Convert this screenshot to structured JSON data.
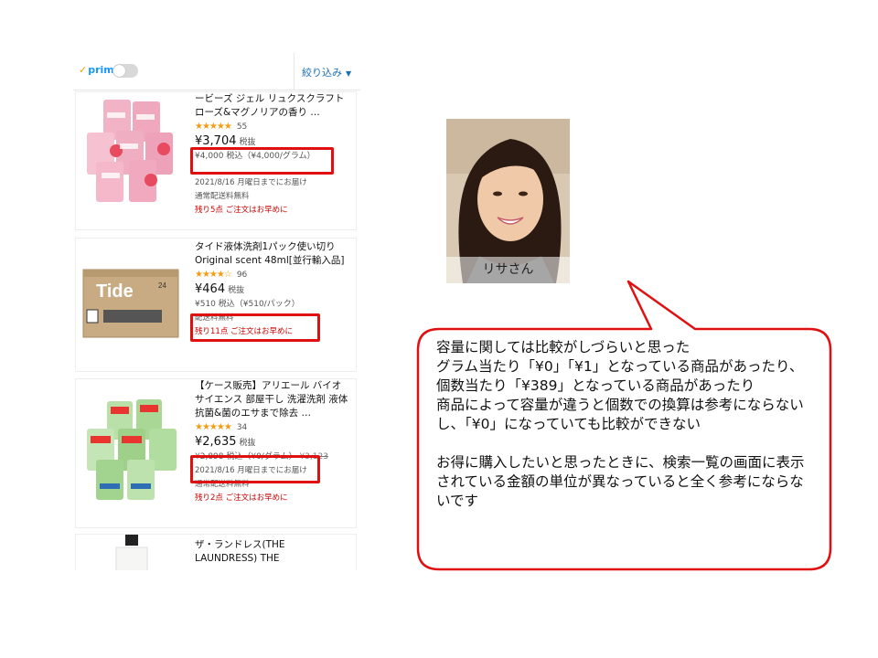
{
  "topbar": {
    "prime_label": "prime",
    "filter_label": "絞り込み"
  },
  "products": [
    {
      "title": "ービーズ ジェル リュクスクラフト ローズ&マグノリアの香り …",
      "rating": "★★★★★",
      "rating_count": "55",
      "price": "¥3,704",
      "tax_note": "税抜",
      "unit_price": "¥4,000 税込（¥4,000/グラム）",
      "delivery": "2021/8/16 月曜日までにお届け",
      "shipping": "通常配送料無料",
      "stock_note": "残り5点 ご注文はお早めに"
    },
    {
      "title": "タイド液体洗剤1パック使い切り Original scent 48ml[並行輸入品]",
      "rating": "★★★★☆",
      "rating_count": "96",
      "price": "¥464",
      "tax_note": "税抜",
      "unit_price": "¥510 税込（¥510/パック）",
      "shipping": "配送料無料",
      "stock_note": "残り11点 ご注文はお早めに"
    },
    {
      "title": "【ケース販売】アリエール バイオサイエンス 部屋干し 洗濯洗剤 液体 抗菌&菌のエサまで除去 …",
      "rating": "★★★★★",
      "rating_count": "34",
      "price": "¥2,635",
      "tax_note": "税抜",
      "unit_price": "¥2,898 税込（¥0/グラム）",
      "list_price": "¥3,123",
      "delivery": "2021/8/16 月曜日までにお届け",
      "shipping": "通常配送料無料",
      "stock_note": "残り2点 ご注文はお早めに"
    },
    {
      "title": "ザ・ランドレス(THE LAUNDRESS) THE"
    }
  ],
  "persona": {
    "name": "リサさん"
  },
  "comment": {
    "paragraph1": "容量に関しては比較がしづらいと思った\nグラム当たり「¥0」「¥1」となっている商品があったり、個数当たり「¥389」となっている商品があったり\n商品によって容量が違うと個数での換算は参考にならないし、「¥0」になっていても比較ができない",
    "paragraph2": "お得に購入したいと思ったときに、検索一覧の画面に表示されている金額の単位が異なっていると全く参考にならないです"
  },
  "colors": {
    "highlight_border": "#e01010",
    "bubble_border": "#e01010",
    "rating_star": "#f39c12",
    "stock_red": "#cc0000"
  }
}
